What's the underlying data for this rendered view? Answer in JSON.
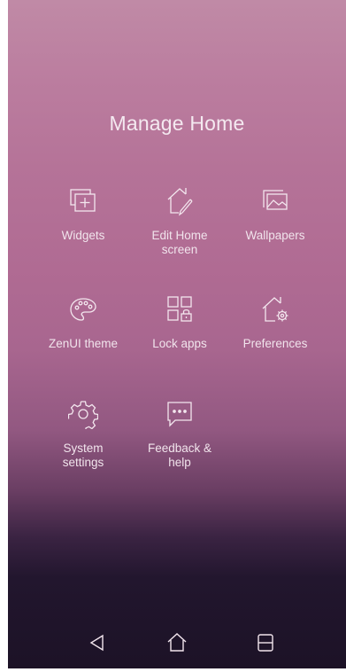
{
  "header": {
    "title": "Manage Home"
  },
  "menu": {
    "items": [
      {
        "label": "Widgets",
        "icon": "widgets-icon"
      },
      {
        "label": "Edit Home\nscreen",
        "icon": "edit-home-icon"
      },
      {
        "label": "Wallpapers",
        "icon": "wallpaper-icon"
      },
      {
        "label": "ZenUI theme",
        "icon": "palette-icon"
      },
      {
        "label": "Lock apps",
        "icon": "lock-apps-icon"
      },
      {
        "label": "Preferences",
        "icon": "home-gear-icon"
      },
      {
        "label": "System\nsettings",
        "icon": "gear-icon"
      },
      {
        "label": "Feedback &\nhelp",
        "icon": "chat-bubble-icon"
      }
    ]
  },
  "navbar": {
    "back": "back-icon",
    "home": "home-icon",
    "recents": "recents-icon"
  },
  "colors": {
    "icon_stroke": "#f3e6ee",
    "text": "#f1e4ec"
  }
}
